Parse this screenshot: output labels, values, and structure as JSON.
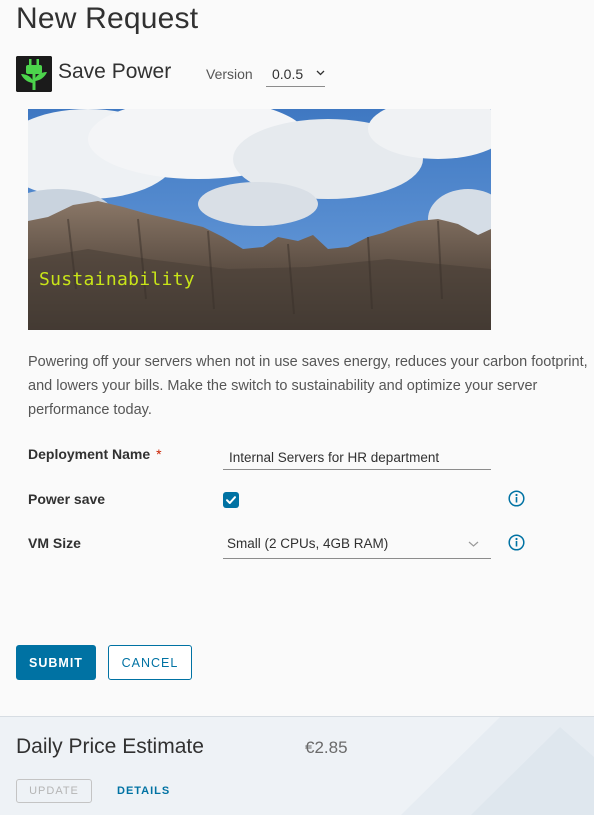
{
  "page": {
    "title": "New Request"
  },
  "app": {
    "name": "Save Power",
    "icon": "plug-leaf-icon",
    "version_label": "Version",
    "version_value": "0.0.5"
  },
  "hero": {
    "caption": "Sustainability"
  },
  "description": "Powering off your servers when not in use saves energy, reduces your carbon footprint, and lowers your bills. Make the switch to sustainability and optimize your server performance today.",
  "form": {
    "deployment_name": {
      "label": "Deployment Name",
      "required_marker": "*",
      "value": "Internal Servers for HR department"
    },
    "power_save": {
      "label": "Power save",
      "checked": true
    },
    "vm_size": {
      "label": "VM Size",
      "value": "Small (2 CPUs, 4GB RAM)"
    }
  },
  "actions": {
    "submit_label": "SUBMIT",
    "cancel_label": "CANCEL"
  },
  "estimate": {
    "title": "Daily Price Estimate",
    "value": "€2.85",
    "update_label": "UPDATE",
    "details_label": "DETAILS"
  },
  "colors": {
    "primary": "#0072a3",
    "required": "#c92100",
    "hero_caption": "#c8e418"
  }
}
